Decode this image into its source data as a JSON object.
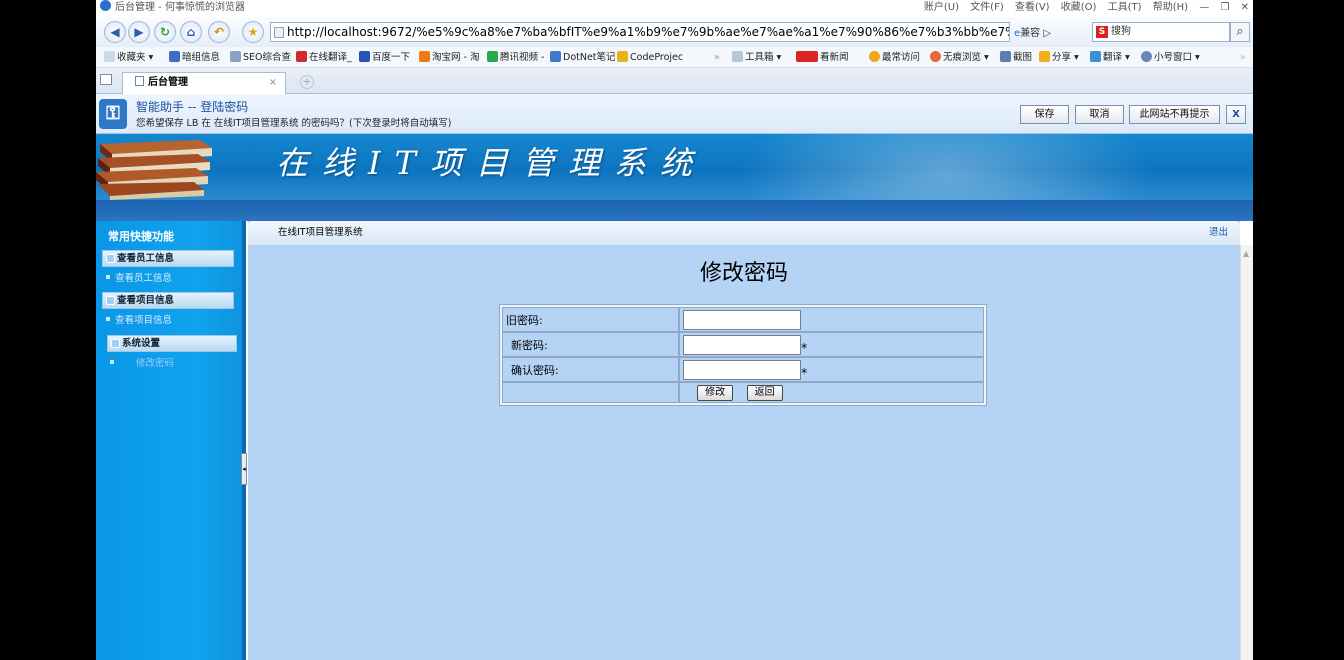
{
  "window": {
    "title": "后台管理 - 何事惊慌的浏览器",
    "menus": [
      "账户(U)",
      "文件(F)",
      "查看(V)",
      "收藏(O)",
      "工具(T)",
      "帮助(H)"
    ],
    "controls": [
      "—",
      "❐",
      "✕"
    ]
  },
  "address": {
    "url": "http://localhost:9672/%e5%9c%a8%e7%ba%bfIT%e9%a1%b9%e7%9b%ae%e7%ae%a1%e7%90%86%e7%b3%bb%e7%bb",
    "compat_label": "兼容",
    "search_text": "搜狗"
  },
  "favorites": [
    {
      "label": "收藏夹 ▾",
      "color": "#c9d8ea"
    },
    {
      "label": "暗组信息",
      "color": "#3b6fc4"
    },
    {
      "label": "SEO综合查",
      "color": "#8aa2c0"
    },
    {
      "label": "在线翻译_",
      "color": "#d02a2a"
    },
    {
      "label": "百度一下",
      "color": "#2855b5"
    },
    {
      "label": "淘宝网 - 淘",
      "color": "#f07a12"
    },
    {
      "label": "腾讯视频 -",
      "color": "#2aa94a"
    },
    {
      "label": "DotNet笔记",
      "color": "#3d79c8"
    },
    {
      "label": "CodeProjec",
      "color": "#e8b21a"
    }
  ],
  "favorites_right": [
    {
      "label": "工具箱 ▾",
      "color": "#b6c6db"
    },
    {
      "label": "看新闻",
      "color": "#d22"
    },
    {
      "label": "最常访问",
      "color": "#f1a81c"
    },
    {
      "label": "无痕浏览 ▾",
      "color": "#e6683a"
    },
    {
      "label": "截图",
      "color": "#5b7db5"
    },
    {
      "label": "分享 ▾",
      "color": "#f0b01c"
    },
    {
      "label": "翻译 ▾",
      "color": "#3d8fd8"
    },
    {
      "label": "小号窗口 ▾",
      "color": "#6a88b5"
    }
  ],
  "tab": {
    "label": "后台管理",
    "close": "×",
    "new": "+"
  },
  "helper": {
    "title": "智能助手 -- 登陆密码",
    "message": "您希望保存 LB 在 在线IT项目管理系统 的密码吗？(下次登录时将自动填写)",
    "save": "保存",
    "cancel": "取消",
    "never": "此网站不再提示",
    "close": "X"
  },
  "app": {
    "title": "在线IT项目管理系统",
    "sidebar": {
      "title": "常用快捷功能",
      "sections": [
        {
          "title": "查看员工信息",
          "link": "查看员工信息"
        },
        {
          "title": "查看项目信息",
          "link": "查看项目信息"
        },
        {
          "title": "系统设置",
          "link": "修改密码"
        }
      ]
    },
    "breadcrumb": "在线IT项目管理系统",
    "logout": "退出",
    "page_title": "修改密码",
    "form": {
      "old_label": "旧密码:",
      "new_label": "新密码:",
      "confirm_label": "确认密码:",
      "old_value": "",
      "new_value": "",
      "confirm_value": "",
      "required_mark": "*",
      "submit": "修改",
      "back": "返回"
    }
  }
}
